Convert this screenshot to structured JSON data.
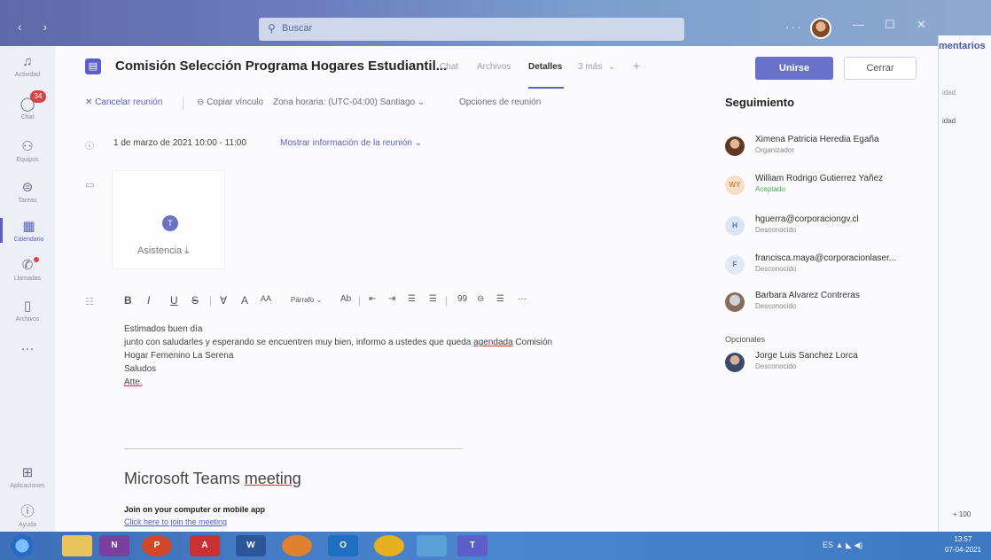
{
  "search": {
    "placeholder": "Buscar"
  },
  "window": {
    "dots": "···",
    "minimize": "—",
    "maximize": "☐",
    "close": "✕"
  },
  "peek": {
    "title": "mentarios",
    "row1": "idad",
    "row2": "idad",
    "zoom": "+ 100"
  },
  "rail": [
    {
      "label": "Actividad",
      "icon": "bell-icon"
    },
    {
      "label": "Chat",
      "icon": "chat-icon",
      "badge": "34"
    },
    {
      "label": "Equipos",
      "icon": "teams-icon"
    },
    {
      "label": "Tareas",
      "icon": "tasks-icon"
    },
    {
      "label": "Calendario",
      "icon": "calendar-icon"
    },
    {
      "label": "Llamadas",
      "icon": "phone-icon"
    },
    {
      "label": "Archivos",
      "icon": "file-icon"
    },
    {
      "label": "···",
      "icon": "more-icon"
    },
    {
      "label": "Aplicaciones",
      "icon": "apps-icon"
    },
    {
      "label": "Ayuda",
      "icon": "help-icon"
    }
  ],
  "header": {
    "title": "Comisión Selección Programa Hogares Estudiantil...",
    "tabs": [
      "Chat",
      "Archivos",
      "Detalles",
      "3 más"
    ],
    "active_tab": "Detalles",
    "add": "+",
    "join": "Unirse",
    "close": "Cerrar"
  },
  "toolbar": {
    "cancel": "Cancelar reunión",
    "copy_link": "Copiar vínculo",
    "timezone": "Zona horaria: (UTC-04:00) Santiago",
    "options": "Opciones de reunión"
  },
  "meeting": {
    "datetime": "1 de marzo de 2021 10:00 - 11:00",
    "more_info": "Mostrar información de la reunión"
  },
  "attendance": {
    "label": "Asistencia"
  },
  "editor": {
    "format_items": [
      "B",
      "I",
      "U",
      "S",
      "|",
      "∀",
      "A",
      "AA",
      "Párrafo",
      "Ab",
      "|",
      "⇤",
      "⇥",
      "☰",
      "☰",
      "|",
      "99",
      "⊖",
      "☰",
      "···"
    ],
    "body": {
      "line1": "Estimados buen día",
      "line2a": "junto con saludarles y esperando se encuentren muy bien, informo a ustedes que queda ",
      "line2b": "agendada",
      "line2c": " Comisión",
      "line3": "Hogar Femenino La Serena",
      "line4": "Saludos",
      "line5": "Atte."
    },
    "teams_a": "Microsoft Teams ",
    "teams_b": "meeting",
    "join_label": "Join on your computer or mobile app",
    "join_link": "Click here to join the meeting"
  },
  "tracking": {
    "title": "Seguimiento",
    "people": [
      {
        "name": "Ximena Patricia Heredia Egaña",
        "status": "Organizador",
        "initials": ""
      },
      {
        "name": "William Rodrigo Gutierrez Yañez",
        "status": "Aceptado",
        "initials": "WY"
      },
      {
        "name": "hguerra@corporaciongv.cl",
        "status": "Desconocido",
        "initials": "H"
      },
      {
        "name": "francisca.maya@corporacionlaser...",
        "status": "Desconocido",
        "initials": "F"
      },
      {
        "name": "Barbara Alvarez Contreras",
        "status": "Desconocido",
        "initials": ""
      }
    ],
    "optional_label": "Opcionales",
    "optional": [
      {
        "name": "Jorge Luis Sanchez Lorca",
        "status": "Desconocido"
      }
    ]
  },
  "taskbar": {
    "apps": [
      "N",
      "P",
      "A",
      "W",
      "",
      "O",
      "",
      "",
      "T"
    ],
    "tray": "ES ▲",
    "time": "13:57",
    "date": "07-04-2021"
  }
}
